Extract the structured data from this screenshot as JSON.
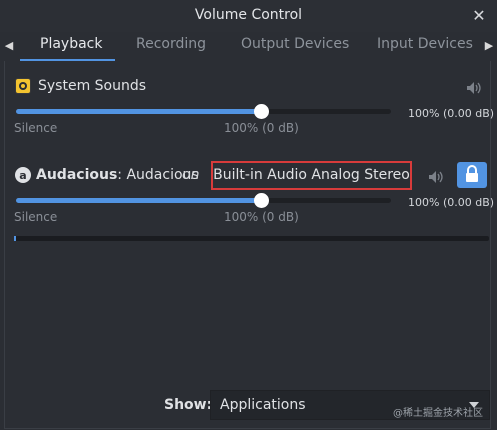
{
  "window": {
    "title": "Volume Control"
  },
  "tabs": [
    {
      "label": "Playback",
      "active": true
    },
    {
      "label": "Recording",
      "active": false
    },
    {
      "label": "Output Devices",
      "active": false
    },
    {
      "label": "Input Devices",
      "active": false
    }
  ],
  "streams": {
    "system": {
      "name": "System Sounds",
      "silence_label": "Silence",
      "mid_label": "100% (0 dB)",
      "value_label": "100% (0.00 dB)",
      "volume_percent": 100
    },
    "audacious": {
      "app": "Audacious",
      "separator": ": ",
      "stream": "Audacious",
      "on_label": "on",
      "device": "Built-in Audio Analog Stereo",
      "silence_label": "Silence",
      "mid_label": "100% (0 dB)",
      "value_label": "100% (0.00 dB)",
      "volume_percent": 100,
      "level_percent": 0
    }
  },
  "footer": {
    "show_label": "Show:",
    "show_value": "Applications"
  },
  "watermark": "@稀土掘金技术社区",
  "colors": {
    "accent": "#5294e2",
    "highlight_border": "#d83b3b",
    "background": "#2b2e34",
    "system_icon": "#f4c430"
  },
  "icons": {
    "tab_left": "triangle-left",
    "tab_right": "triangle-right",
    "close": "x-mark",
    "speaker": "speaker-wave",
    "lock": "lock"
  }
}
